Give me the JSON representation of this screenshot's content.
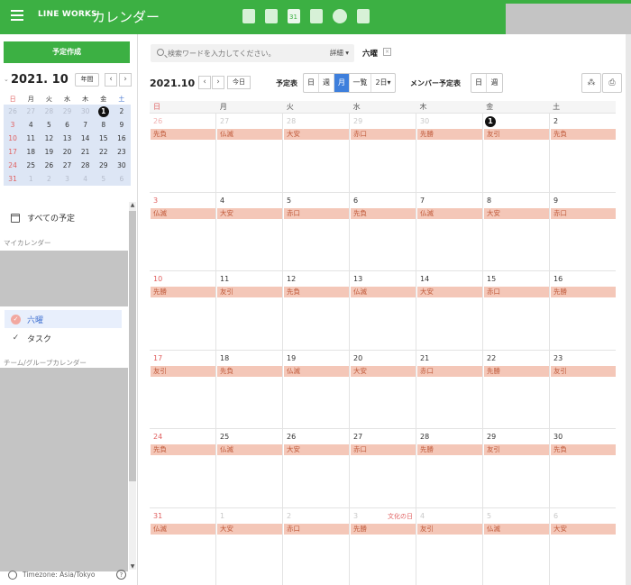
{
  "topbar": {
    "brand": "LINE WORKS",
    "app_name": "カレンダー",
    "apps": [
      "note-icon",
      "chat-icon",
      "calendar-icon",
      "contacts-icon",
      "task-icon",
      "approval-icon"
    ],
    "active_app_day": "31"
  },
  "sidebar": {
    "create_label": "予定作成",
    "mini_title": "2021. 10",
    "year_label": "年間",
    "weekdays": [
      "日",
      "月",
      "火",
      "水",
      "木",
      "金",
      "土"
    ],
    "weeks": [
      [
        "26",
        "27",
        "28",
        "29",
        "30",
        "1",
        "2"
      ],
      [
        "3",
        "4",
        "5",
        "6",
        "7",
        "8",
        "9"
      ],
      [
        "10",
        "11",
        "12",
        "13",
        "14",
        "15",
        "16"
      ],
      [
        "17",
        "18",
        "19",
        "20",
        "21",
        "22",
        "23"
      ],
      [
        "24",
        "25",
        "26",
        "27",
        "28",
        "29",
        "30"
      ],
      [
        "31",
        "1",
        "2",
        "3",
        "4",
        "5",
        "6"
      ]
    ],
    "all_schedules": "すべての予定",
    "my_calendar": "マイカレンダー",
    "calendars": [
      {
        "name": "六曜",
        "selected": true
      },
      {
        "name": "タスク",
        "selected": false
      }
    ],
    "team_calendar": "チーム/グループカレンダー",
    "timezone": "Timezone: Asia/Tokyo",
    "help": "?"
  },
  "main": {
    "search_placeholder": "検索ワードを入力してください。",
    "search_detail": "詳細 ▾",
    "rokuyo_title": "六曜",
    "month_label": "2021.10",
    "today_label": "今日",
    "schedule_label": "予定表",
    "views": [
      "日",
      "週",
      "月",
      "一覧",
      "2日▾"
    ],
    "active_view": "月",
    "member_label": "メンバー予定表",
    "member_views": [
      "日",
      "週"
    ],
    "weekday_headers": [
      "日",
      "月",
      "火",
      "水",
      "木",
      "金",
      "土"
    ],
    "weeks": [
      {
        "days": [
          {
            "d": "26",
            "ev": "先負",
            "fade": true
          },
          {
            "d": "27",
            "ev": "仏滅",
            "fade": true
          },
          {
            "d": "28",
            "ev": "大安",
            "fade": true
          },
          {
            "d": "29",
            "ev": "赤口",
            "fade": true
          },
          {
            "d": "30",
            "ev": "先勝",
            "fade": true
          },
          {
            "d": "1",
            "ev": "友引",
            "today": true
          },
          {
            "d": "2",
            "ev": "先負"
          }
        ]
      },
      {
        "days": [
          {
            "d": "3",
            "ev": "仏滅"
          },
          {
            "d": "4",
            "ev": "大安"
          },
          {
            "d": "5",
            "ev": "赤口"
          },
          {
            "d": "6",
            "ev": "先負"
          },
          {
            "d": "7",
            "ev": "仏滅"
          },
          {
            "d": "8",
            "ev": "大安"
          },
          {
            "d": "9",
            "ev": "赤口"
          }
        ]
      },
      {
        "days": [
          {
            "d": "10",
            "ev": "先勝"
          },
          {
            "d": "11",
            "ev": "友引"
          },
          {
            "d": "12",
            "ev": "先負"
          },
          {
            "d": "13",
            "ev": "仏滅"
          },
          {
            "d": "14",
            "ev": "大安"
          },
          {
            "d": "15",
            "ev": "赤口"
          },
          {
            "d": "16",
            "ev": "先勝"
          }
        ]
      },
      {
        "days": [
          {
            "d": "17",
            "ev": "友引"
          },
          {
            "d": "18",
            "ev": "先負"
          },
          {
            "d": "19",
            "ev": "仏滅"
          },
          {
            "d": "20",
            "ev": "大安"
          },
          {
            "d": "21",
            "ev": "赤口"
          },
          {
            "d": "22",
            "ev": "先勝"
          },
          {
            "d": "23",
            "ev": "友引"
          }
        ]
      },
      {
        "days": [
          {
            "d": "24",
            "ev": "先負"
          },
          {
            "d": "25",
            "ev": "仏滅"
          },
          {
            "d": "26",
            "ev": "大安"
          },
          {
            "d": "27",
            "ev": "赤口"
          },
          {
            "d": "28",
            "ev": "先勝"
          },
          {
            "d": "29",
            "ev": "友引"
          },
          {
            "d": "30",
            "ev": "先負"
          }
        ]
      },
      {
        "days": [
          {
            "d": "31",
            "ev": "仏滅"
          },
          {
            "d": "1",
            "ev": "大安",
            "fade": true
          },
          {
            "d": "2",
            "ev": "赤口",
            "fade": true
          },
          {
            "d": "3",
            "ev": "先勝",
            "fade": true,
            "holiday": "文化の日"
          },
          {
            "d": "4",
            "ev": "友引",
            "fade": true
          },
          {
            "d": "5",
            "ev": "仏滅",
            "fade": true
          },
          {
            "d": "6",
            "ev": "大安",
            "fade": true
          }
        ]
      }
    ]
  },
  "colors": {
    "brand_green": "#3cb043",
    "accent_blue": "#3e7fdc",
    "event_bg": "#f4c7b8",
    "event_text": "#c05a3a",
    "sunday_red": "#e06060"
  }
}
